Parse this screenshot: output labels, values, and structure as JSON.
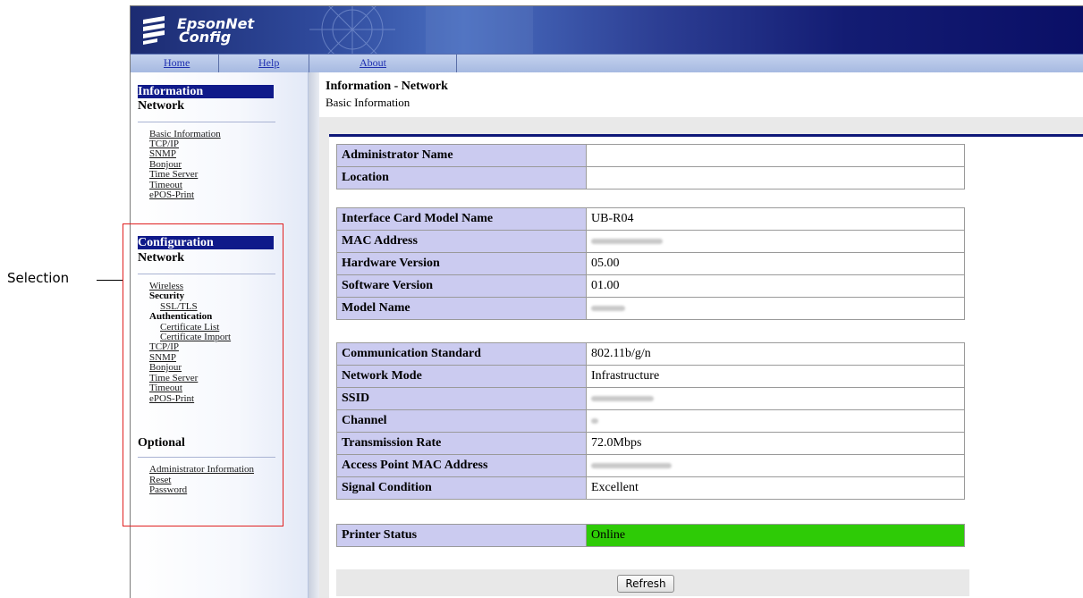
{
  "annotation": {
    "label": "Selection",
    "box_color": "#e02020"
  },
  "app": {
    "logo_line1": "EpsonNet",
    "logo_line2": "Config"
  },
  "nav": {
    "home": "Home",
    "help": "Help",
    "about": "About"
  },
  "sidebar": {
    "information": {
      "header": "Information",
      "subheader": "Network",
      "links": [
        "Basic Information",
        "TCP/IP",
        "SNMP",
        "Bonjour",
        "Time Server",
        "Timeout",
        "ePOS-Print"
      ]
    },
    "configuration": {
      "header": "Configuration",
      "subheader": "Network",
      "wireless": "Wireless",
      "security_label": "Security",
      "ssl_tls": "SSL/TLS",
      "authentication_label": "Authentication",
      "certificate_list": "Certificate List",
      "certificate_import": "Certificate Import",
      "links": [
        "TCP/IP",
        "SNMP",
        "Bonjour",
        "Time Server",
        "Timeout",
        "ePOS-Print"
      ]
    },
    "optional": {
      "header": "Optional",
      "links": [
        "Administrator Information",
        "Reset",
        "Password"
      ]
    }
  },
  "main": {
    "title": "Information - Network",
    "subtitle": "Basic Information",
    "group1": [
      {
        "key": "Administrator Name",
        "value": ""
      },
      {
        "key": "Location",
        "value": ""
      }
    ],
    "group2": [
      {
        "key": "Interface Card Model Name",
        "value": "UB-R04"
      },
      {
        "key": "MAC Address",
        "value": ""
      },
      {
        "key": "Hardware Version",
        "value": "05.00"
      },
      {
        "key": "Software Version",
        "value": "01.00"
      },
      {
        "key": "Model Name",
        "value": ""
      }
    ],
    "group3": [
      {
        "key": "Communication Standard",
        "value": "802.11b/g/n"
      },
      {
        "key": "Network Mode",
        "value": "Infrastructure"
      },
      {
        "key": "SSID",
        "value": ""
      },
      {
        "key": "Channel",
        "value": ""
      },
      {
        "key": "Transmission Rate",
        "value": "72.0Mbps"
      },
      {
        "key": "Access Point MAC Address",
        "value": ""
      },
      {
        "key": "Signal Condition",
        "value": "Excellent"
      }
    ],
    "group4": [
      {
        "key": "Printer Status",
        "value": "Online",
        "status_color": "#2ecb06"
      }
    ],
    "refresh_label": "Refresh"
  }
}
